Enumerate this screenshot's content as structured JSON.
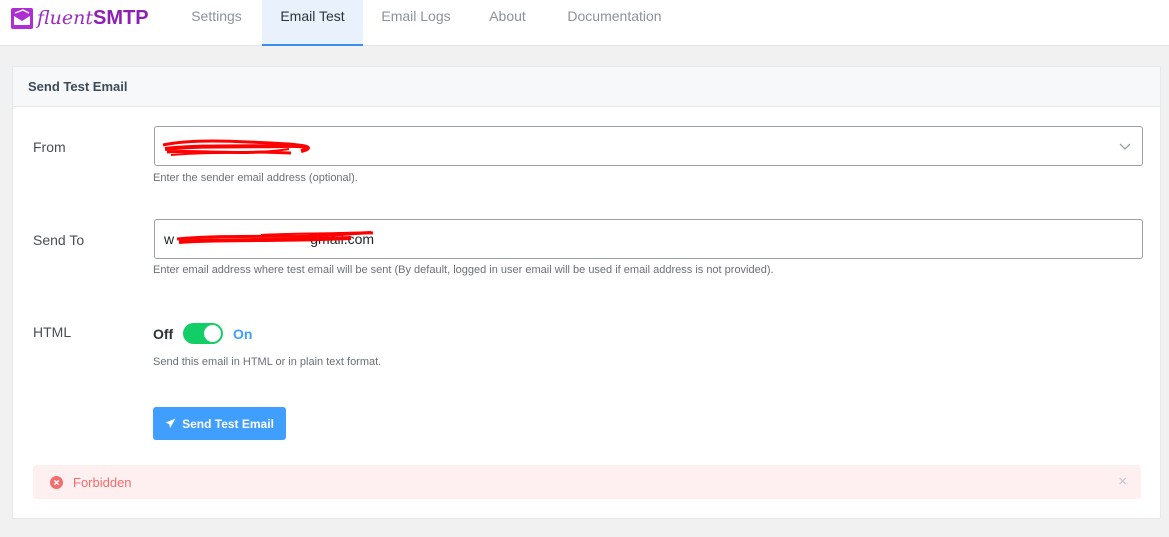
{
  "brand": {
    "name_light": "fluent",
    "name_bold": "SMTP",
    "color": "#9a2dbf"
  },
  "nav": {
    "tabs": [
      {
        "label": "Settings",
        "active": false
      },
      {
        "label": "Email Test",
        "active": true
      },
      {
        "label": "Email Logs",
        "active": false
      },
      {
        "label": "About",
        "active": false
      },
      {
        "label": "Documentation",
        "active": false
      }
    ]
  },
  "card": {
    "title": "Send Test Email"
  },
  "form": {
    "from": {
      "label": "From",
      "value": "",
      "hint": "Enter the sender email address (optional).",
      "icon": "chevron-down-icon"
    },
    "send_to": {
      "label": "Send To",
      "value": "w                                   gmail.com",
      "hint": "Enter email address where test email will be sent (By default, logged in user email will be used if email address is not provided)."
    },
    "html": {
      "label": "HTML",
      "off_label": "Off",
      "on_label": "On",
      "enabled": true,
      "hint": "Send this email in HTML or in plain text format."
    },
    "submit": {
      "label": "Send Test Email",
      "icon": "paper-plane-icon"
    }
  },
  "alert": {
    "text": "Forbidden",
    "type": "error",
    "icon": "error-circle-icon",
    "close": "×"
  },
  "colors": {
    "accent": "#409eff",
    "toggle_on": "#13ce66",
    "error": "#f56c6c",
    "error_bg": "#fef0f0",
    "redaction": "#ff0000"
  }
}
